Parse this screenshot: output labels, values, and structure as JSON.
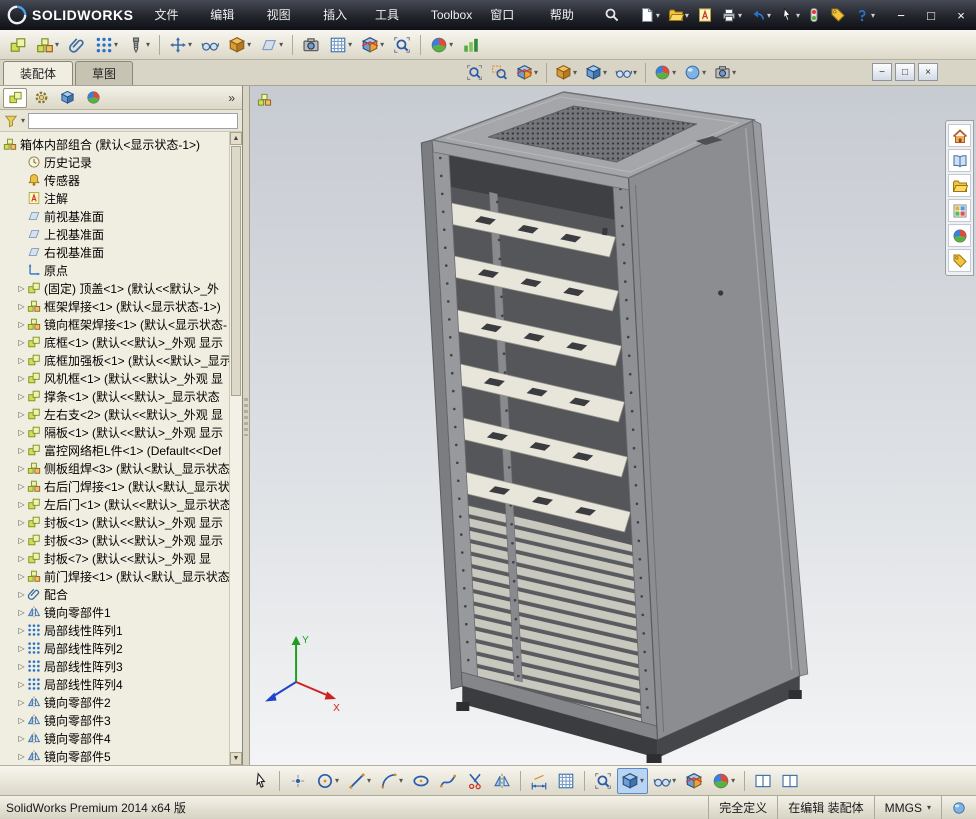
{
  "titlebar": {
    "brand": "SOLIDWORKS",
    "menus": [
      "文件(F)",
      "编辑(E)",
      "视图(V)",
      "插入(I)",
      "工具(T)",
      "Toolbox",
      "窗口(W)",
      "帮助(H)"
    ],
    "quick_tools": [
      {
        "name": "new-document",
        "icon": "page",
        "dropdown": true
      },
      {
        "name": "open-document",
        "icon": "folder",
        "dropdown": true
      },
      {
        "name": "make-drawing",
        "icon": "noteA",
        "dropdown": false
      },
      {
        "name": "print",
        "icon": "printer",
        "dropdown": true
      },
      {
        "name": "undo",
        "icon": "undo",
        "dropdown": true
      },
      {
        "name": "select",
        "icon": "cursor",
        "dropdown": true
      }
    ],
    "right_tools": [
      {
        "name": "rebuild",
        "icon": "rebuild",
        "dropdown": false
      },
      {
        "name": "file-properties",
        "icon": "tag",
        "dropdown": false
      },
      {
        "name": "help",
        "icon": "question",
        "dropdown": true
      }
    ]
  },
  "assembly_toolbar": {
    "tools": [
      {
        "name": "edit-component",
        "icon": "part",
        "dropdown": false
      },
      {
        "name": "insert-components",
        "icon": "assembly",
        "dropdown": true
      },
      {
        "name": "mate",
        "icon": "paperclip",
        "dropdown": false
      },
      {
        "name": "linear-component-pattern",
        "icon": "dots",
        "dropdown": true
      },
      {
        "name": "smart-fasteners",
        "icon": "screw",
        "dropdown": true
      },
      {
        "sep": true
      },
      {
        "name": "move-component",
        "icon": "move",
        "dropdown": true
      },
      {
        "name": "show-hidden-components",
        "icon": "eye",
        "dropdown": false
      },
      {
        "name": "assembly-features",
        "icon": "cube",
        "dropdown": true
      },
      {
        "name": "reference-geometry",
        "icon": "plane",
        "dropdown": true
      },
      {
        "sep": true
      },
      {
        "name": "new-motion-study",
        "icon": "camera",
        "dropdown": false
      },
      {
        "name": "bill-of-materials",
        "icon": "grid",
        "dropdown": true
      },
      {
        "name": "exploded-view",
        "icon": "section",
        "dropdown": true
      },
      {
        "name": "interference-detection",
        "icon": "magfit",
        "dropdown": false
      },
      {
        "sep": true
      },
      {
        "name": "edit-appearance",
        "icon": "spherecolor",
        "dropdown": true
      },
      {
        "name": "simulation-advisor",
        "icon": "chart",
        "dropdown": false
      }
    ]
  },
  "tab_strip": {
    "doc_tabs": [
      {
        "label": "装配体",
        "active": true
      },
      {
        "label": "草图",
        "active": false
      }
    ],
    "headsup_tools": [
      {
        "name": "zoom-to-fit",
        "icon": "magfit",
        "dropdown": false
      },
      {
        "name": "zoom-to-area",
        "icon": "magarea",
        "dropdown": false
      },
      {
        "name": "section-view",
        "icon": "section",
        "dropdown": true
      },
      {
        "sep": true
      },
      {
        "name": "view-orientation",
        "icon": "cube",
        "dropdown": true
      },
      {
        "name": "display-style",
        "icon": "cubeblue",
        "dropdown": true
      },
      {
        "name": "hide-show-items",
        "icon": "eye",
        "dropdown": true
      },
      {
        "sep": true
      },
      {
        "name": "edit-appearance",
        "icon": "spherecolor",
        "dropdown": true
      },
      {
        "name": "apply-scene",
        "icon": "sphere",
        "dropdown": true
      },
      {
        "name": "view-settings",
        "icon": "camera",
        "dropdown": true
      }
    ]
  },
  "feature_panel": {
    "manager_tabs": [
      {
        "name": "featuremanager-tree",
        "icon": "part",
        "active": true
      },
      {
        "name": "propertymanager",
        "icon": "gear",
        "active": false
      },
      {
        "name": "configurationmanager",
        "icon": "cubeblue",
        "active": false
      },
      {
        "name": "displaymanager",
        "icon": "spherecolor",
        "active": false
      }
    ],
    "more_label": "»",
    "tree": {
      "root": {
        "label": "箱体内部组合 (默认<显示状态-1>)",
        "icon": "assembly"
      },
      "items": [
        {
          "label": "历史记录",
          "icon": "clock",
          "exp": false
        },
        {
          "label": "传感器",
          "icon": "bell",
          "exp": false
        },
        {
          "label": "注解",
          "icon": "noteA",
          "exp": false
        },
        {
          "label": "前视基准面",
          "icon": "plane",
          "exp": false
        },
        {
          "label": "上视基准面",
          "icon": "plane",
          "exp": false
        },
        {
          "label": "右视基准面",
          "icon": "plane",
          "exp": false
        },
        {
          "label": "原点",
          "icon": "axes",
          "exp": false
        },
        {
          "label": "(固定) 顶盖<1> (默认<<默认>_外",
          "icon": "part",
          "exp": true
        },
        {
          "label": "框架焊接<1> (默认<显示状态-1>)",
          "icon": "assembly",
          "exp": true
        },
        {
          "label": "镜向框架焊接<1> (默认<显示状态-",
          "icon": "assembly",
          "exp": true
        },
        {
          "label": "底框<1> (默认<<默认>_外观 显示",
          "icon": "part",
          "exp": true
        },
        {
          "label": "底框加强板<1> (默认<<默认>_显示",
          "icon": "part",
          "exp": true
        },
        {
          "label": "风机框<1> (默认<<默认>_外观 显",
          "icon": "part",
          "exp": true
        },
        {
          "label": "撑条<1> (默认<<默认>_显示状态",
          "icon": "part",
          "exp": true
        },
        {
          "label": "左右支<2> (默认<<默认>_外观 显",
          "icon": "part",
          "exp": true
        },
        {
          "label": "隔板<1> (默认<<默认>_外观 显示",
          "icon": "part",
          "exp": true
        },
        {
          "label": "富控网络柜L件<1> (Default<<Def",
          "icon": "part",
          "exp": true
        },
        {
          "label": "侧板组焊<3> (默认<默认_显示状态",
          "icon": "assembly",
          "exp": true
        },
        {
          "label": "右后门焊接<1> (默认<默认_显示状",
          "icon": "assembly",
          "exp": true
        },
        {
          "label": "左后门<1> (默认<<默认>_显示状态",
          "icon": "part",
          "exp": true
        },
        {
          "label": "封板<1> (默认<<默认>_外观 显示",
          "icon": "part",
          "exp": true
        },
        {
          "label": "封板<3> (默认<<默认>_外观 显示",
          "icon": "part",
          "exp": true
        },
        {
          "label": "封板<7> (默认<<默认>_外观 显",
          "icon": "part",
          "exp": true
        },
        {
          "label": "前门焊接<1> (默认<默认_显示状态",
          "icon": "assembly",
          "exp": true
        },
        {
          "label": "配合",
          "icon": "paperclip",
          "exp": true
        },
        {
          "label": "镜向零部件1",
          "icon": "mirror",
          "exp": true
        },
        {
          "label": "局部线性阵列1",
          "icon": "dots",
          "exp": true
        },
        {
          "label": "局部线性阵列2",
          "icon": "dots",
          "exp": true
        },
        {
          "label": "局部线性阵列3",
          "icon": "dots",
          "exp": true
        },
        {
          "label": "局部线性阵列4",
          "icon": "dots",
          "exp": true
        },
        {
          "label": "镜向零部件2",
          "icon": "mirror",
          "exp": true
        },
        {
          "label": "镜向零部件3",
          "icon": "mirror",
          "exp": true
        },
        {
          "label": "镜向零部件4",
          "icon": "mirror",
          "exp": true
        },
        {
          "label": "镜向零部件5",
          "icon": "mirror",
          "exp": true
        }
      ]
    }
  },
  "task_pane": {
    "tools": [
      {
        "name": "solidworks-resources",
        "icon": "home",
        "dropdown": false
      },
      {
        "name": "design-library",
        "icon": "book",
        "dropdown": false
      },
      {
        "name": "file-explorer",
        "icon": "folder",
        "dropdown": false
      },
      {
        "name": "view-palette",
        "icon": "palette",
        "dropdown": false
      },
      {
        "name": "appearances-scenes",
        "icon": "spherecolor",
        "dropdown": false
      },
      {
        "name": "custom-properties",
        "icon": "tag",
        "dropdown": false
      }
    ]
  },
  "sketch_toolbar": {
    "tools": [
      {
        "name": "select",
        "icon": "cursor",
        "dropdown": false
      },
      {
        "sep": true
      },
      {
        "name": "sketch-point",
        "icon": "point",
        "dropdown": false
      },
      {
        "name": "circle",
        "icon": "circle",
        "dropdown": true
      },
      {
        "name": "line",
        "icon": "line",
        "dropdown": true
      },
      {
        "name": "arc",
        "icon": "arc",
        "dropdown": true
      },
      {
        "name": "ellipse",
        "icon": "ellipse",
        "dropdown": false
      },
      {
        "name": "spline",
        "icon": "spline",
        "dropdown": false
      },
      {
        "name": "trim-entities",
        "icon": "trim",
        "dropdown": false
      },
      {
        "name": "mirror-entities",
        "icon": "mirror",
        "dropdown": false
      },
      {
        "sep": true
      },
      {
        "name": "smart-dimension",
        "icon": "dim",
        "dropdown": false
      },
      {
        "name": "grid-snap",
        "icon": "grid",
        "dropdown": false
      },
      {
        "sep": true
      },
      {
        "name": "zoom-to-fit",
        "icon": "magfit",
        "dropdown": false
      },
      {
        "name": "display-style",
        "icon": "cubeblue",
        "dropdown": true,
        "active": true
      },
      {
        "name": "hide-show-items",
        "icon": "eye",
        "dropdown": true
      },
      {
        "name": "section-view",
        "icon": "section",
        "dropdown": false
      },
      {
        "name": "edit-appearance",
        "icon": "spherecolor",
        "dropdown": true
      },
      {
        "sep": true
      },
      {
        "name": "split-view-horizontal",
        "icon": "splitview",
        "dropdown": false
      },
      {
        "name": "split-view-vertical",
        "icon": "splitview",
        "dropdown": false
      }
    ]
  },
  "viewport": {
    "triad": {
      "x_label": "X",
      "y_label": "Y"
    }
  },
  "statusbar": {
    "left_text": "SolidWorks Premium 2014 x64 版",
    "constraint_status": "完全定义",
    "edit_status": "在编辑 装配体",
    "units": "MMGS"
  }
}
